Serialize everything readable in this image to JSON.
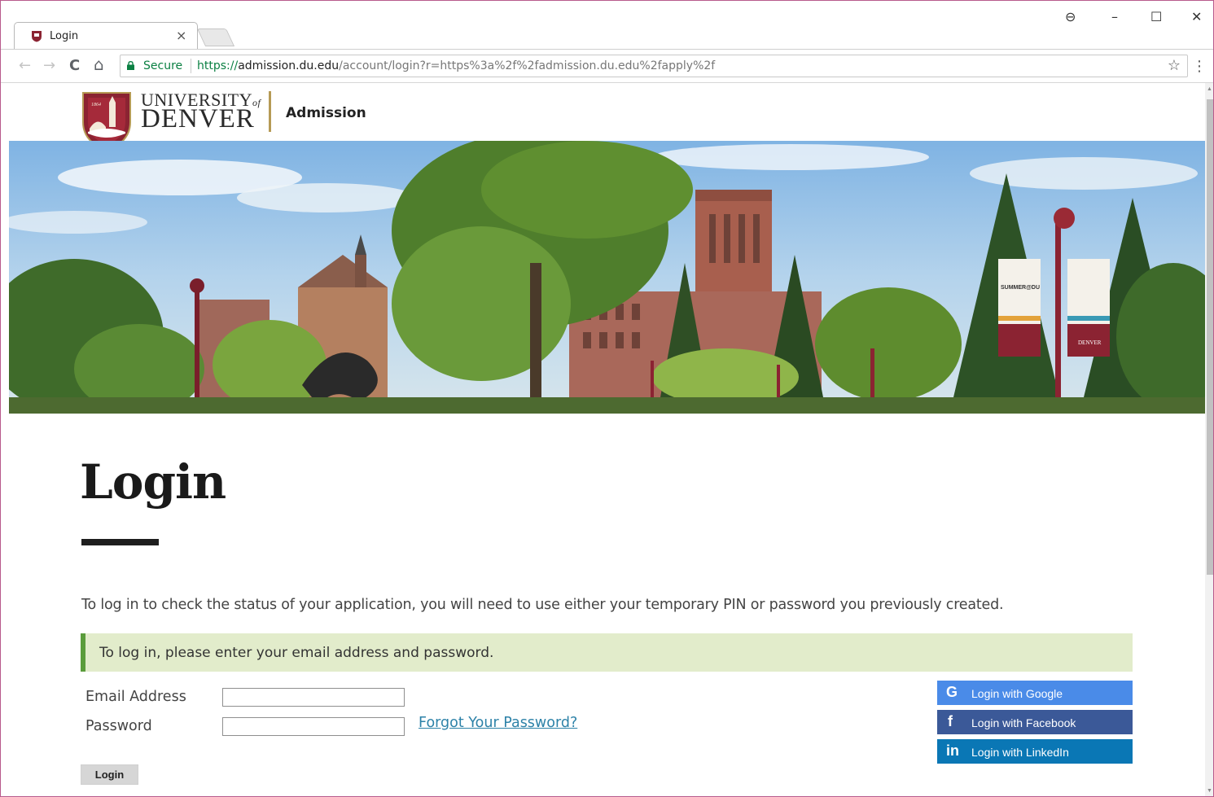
{
  "browser": {
    "tab_title": "Login",
    "tab_close": "×",
    "window_controls": {
      "account": "⊖",
      "minimize": "–",
      "maximize": "☐",
      "close": "✕"
    },
    "nav": {
      "back": "←",
      "forward": "→",
      "reload": "C",
      "home": "⌂"
    },
    "security_label": "Secure",
    "url": {
      "scheme": "https://",
      "host": "admission.du.edu",
      "path": "/account/login?r=https%3a%2f%2fadmission.du.edu%2fapply%2f"
    },
    "bookmark_star": "☆",
    "menu": "⋮"
  },
  "header": {
    "crest_year": "1864",
    "wordmark_top": "UNIVERSITY",
    "wordmark_of": "of",
    "wordmark_bottom": "DENVER",
    "section": "Admission"
  },
  "hero": {
    "banner_left_text": "SUMMER@DU",
    "banner_right_text": "DENVER"
  },
  "page": {
    "title": "Login",
    "intro": "To log in to check the status of your application, you will need to use either your temporary PIN or password you previously created.",
    "notice": "To log in, please enter your email address and password."
  },
  "form": {
    "email_label": "Email Address",
    "email_value": "",
    "password_label": "Password",
    "password_value": "",
    "forgot_link": "Forgot Your Password?",
    "submit_label": "Login"
  },
  "social": {
    "google": {
      "icon": "G",
      "label": "Login with Google"
    },
    "facebook": {
      "icon": "f",
      "label": "Login with Facebook"
    },
    "linkedin": {
      "icon": "in",
      "label": "Login with LinkedIn"
    }
  },
  "colors": {
    "brand_red": "#8b2332",
    "gold": "#b69a55",
    "notice_bg": "#e2eccb",
    "notice_border": "#5a9c3b",
    "link": "#2d82a8",
    "google": "#4a8be8",
    "facebook": "#3b5998",
    "linkedin": "#0a77b5"
  }
}
